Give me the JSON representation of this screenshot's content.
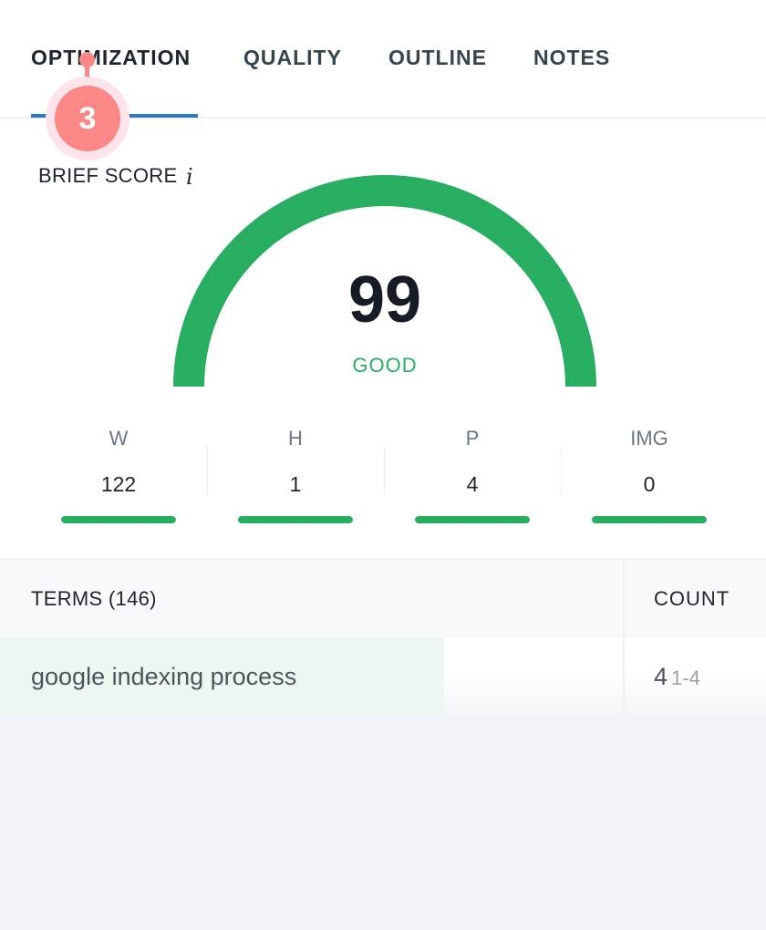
{
  "tabs": [
    {
      "label": "OPTIMIZATION",
      "active": true
    },
    {
      "label": "QUALITY",
      "active": false
    },
    {
      "label": "OUTLINE",
      "active": false
    },
    {
      "label": "NOTES",
      "active": false
    }
  ],
  "badge": {
    "count": "3"
  },
  "brief_score": {
    "label": "BRIEF SCORE",
    "info_icon": "i",
    "value": "99",
    "max": 100,
    "status": "GOOD",
    "color": "#27ae60"
  },
  "metrics": [
    {
      "label": "W",
      "value": "122",
      "progress": 1.0
    },
    {
      "label": "H",
      "value": "1",
      "progress": 1.0
    },
    {
      "label": "P",
      "value": "4",
      "progress": 1.0
    },
    {
      "label": "IMG",
      "value": "0",
      "progress": 1.0
    }
  ],
  "terms_table": {
    "header_terms": "TERMS (146)",
    "header_count": "COUNT",
    "rows": [
      {
        "term": "google indexing process",
        "count": "4",
        "range": "1-4",
        "progress": 0.58
      }
    ]
  },
  "colors": {
    "accent": "#2b78d0",
    "good": "#27ae60",
    "badge": "#fb8886"
  }
}
